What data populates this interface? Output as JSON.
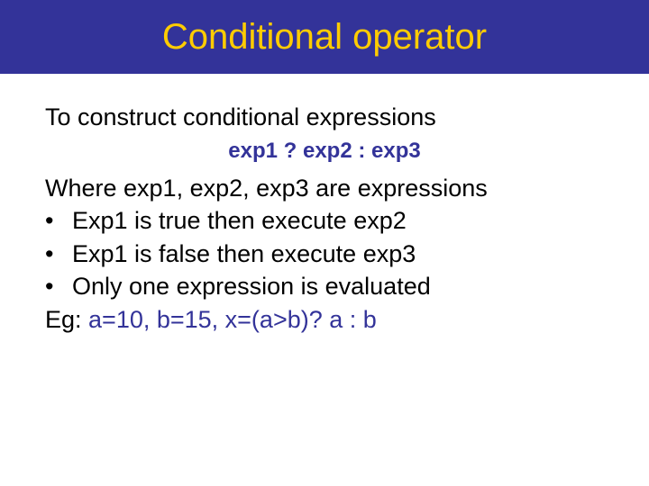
{
  "title": "Conditional operator",
  "intro": "To construct conditional expressions",
  "syntax": "exp1 ? exp2 : exp3",
  "line_where": "Where exp1, exp2, exp3 are expressions",
  "bullets": [
    "Exp1 is true then execute exp2",
    "Exp1 is false then execute exp3",
    "Only one expression is evaluated"
  ],
  "eg_label": "Eg: ",
  "eg_code": "a=10, b=15, x=(a>b)? a : b"
}
